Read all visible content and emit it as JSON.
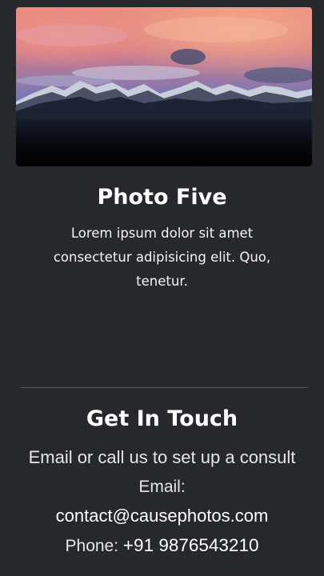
{
  "photo": {
    "title": "Photo Five",
    "description": "Lorem ipsum dolor sit amet consectetur adipisicing elit. Quo, tenetur."
  },
  "contact": {
    "title": "Get In Touch",
    "tagline": "Email or call us to set up a consult",
    "email_label": "Email:",
    "email_value": "contact@causephotos.com",
    "phone_label": "Phone:",
    "phone_value": "+91 9876543210"
  },
  "colors": {
    "background": "#26282c",
    "text": "#ffffff",
    "divider": "#54575c"
  }
}
